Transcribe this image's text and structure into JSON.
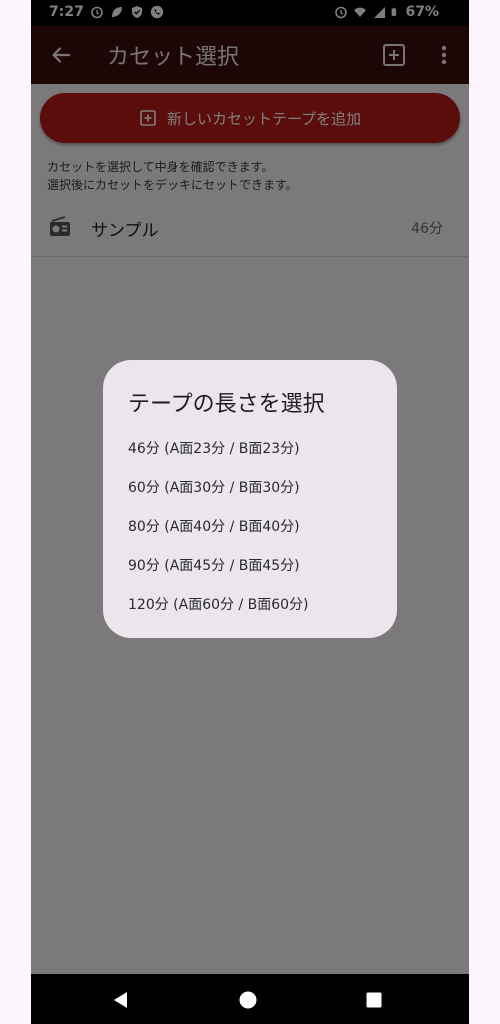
{
  "status_bar": {
    "time": "7:27",
    "battery": "67%"
  },
  "app_bar": {
    "title": "カセット選択"
  },
  "main": {
    "add_button_label": "新しいカセットテープを追加",
    "hint_line1": "カセットを選択して中身を確認できます。",
    "hint_line2": "選択後にカセットをデッキにセットできます。",
    "cassettes": [
      {
        "name": "サンプル",
        "length": "46分"
      }
    ]
  },
  "dialog": {
    "title": "テープの長さを選択",
    "options": [
      "46分 (A面23分 / B面23分)",
      "60分 (A面30分 / B面30分)",
      "80分 (A面40分 / B面40分)",
      "90分 (A面45分 / B面45分)",
      "120分 (A面60分 / B面60分)"
    ]
  },
  "colors": {
    "app_bar": "#3b0f0c",
    "accent": "#b51a17",
    "dialog_bg": "#ebe6ee"
  }
}
